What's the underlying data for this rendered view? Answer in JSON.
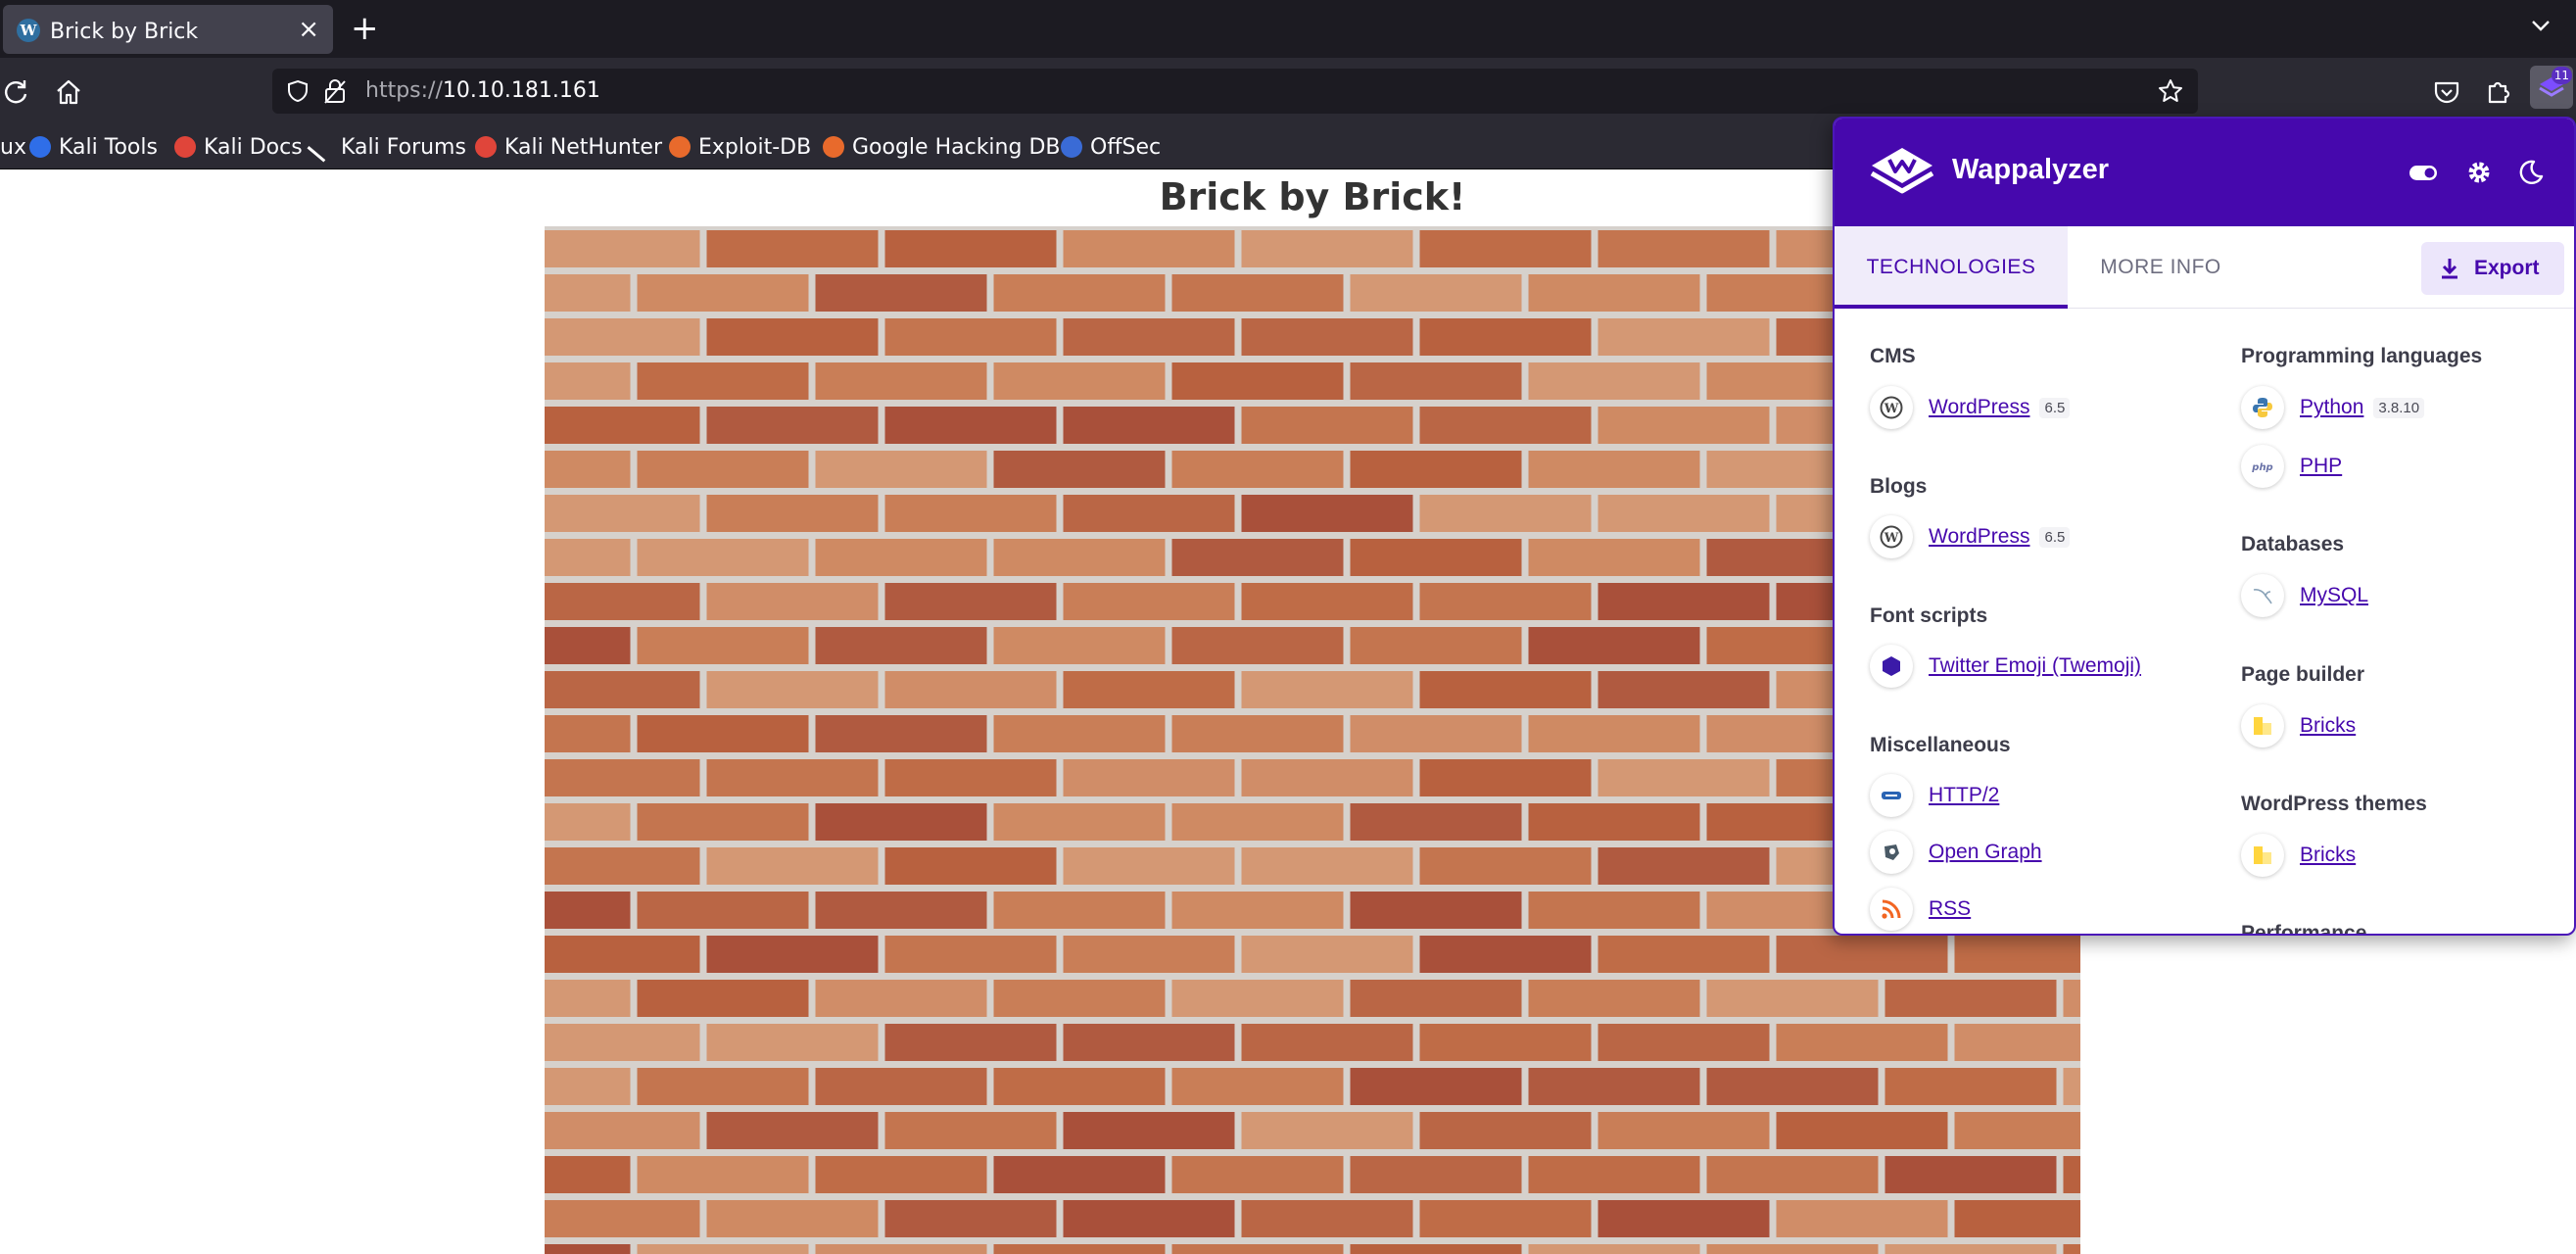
{
  "browser": {
    "tab_title": "Brick by Brick",
    "tab_close": "×",
    "new_tab": "+",
    "url_proto": "https://",
    "url_host": "10.10.181.161",
    "extension_badge": "11",
    "bookmarks": [
      "ux",
      "Kali Tools",
      "Kali Docs",
      "Kali Forums",
      "Kali NetHunter",
      "Exploit-DB",
      "Google Hacking DB",
      "OffSec"
    ]
  },
  "page": {
    "heading": "Brick by Brick!"
  },
  "wappalyzer": {
    "brand": "Wappalyzer",
    "tabs": {
      "technologies": "TECHNOLOGIES",
      "more_info": "MORE INFO"
    },
    "export_label": "Export",
    "left_categories": [
      {
        "name": "CMS",
        "items": [
          {
            "name": "WordPress",
            "version": "6.5",
            "icon": "wordpress-icon"
          }
        ]
      },
      {
        "name": "Blogs",
        "items": [
          {
            "name": "WordPress",
            "version": "6.5",
            "icon": "wordpress-icon"
          }
        ]
      },
      {
        "name": "Font scripts",
        "items": [
          {
            "name": "Twitter Emoji (Twemoji)",
            "version": "",
            "icon": "twemoji-icon"
          }
        ]
      },
      {
        "name": "Miscellaneous",
        "items": [
          {
            "name": "HTTP/2",
            "version": "",
            "icon": "http2-icon"
          },
          {
            "name": "Open Graph",
            "version": "",
            "icon": "open-graph-icon"
          },
          {
            "name": "RSS",
            "version": "",
            "icon": "rss-icon"
          }
        ]
      }
    ],
    "right_categories": [
      {
        "name": "Programming languages",
        "items": [
          {
            "name": "Python",
            "version": "3.8.10",
            "icon": "python-icon"
          },
          {
            "name": "PHP",
            "version": "",
            "icon": "php-icon"
          }
        ]
      },
      {
        "name": "Databases",
        "items": [
          {
            "name": "MySQL",
            "version": "",
            "icon": "mysql-icon"
          }
        ]
      },
      {
        "name": "Page builder",
        "items": [
          {
            "name": "Bricks",
            "version": "",
            "icon": "bricks-icon"
          }
        ]
      },
      {
        "name": "WordPress themes",
        "items": [
          {
            "name": "Bricks",
            "version": "",
            "icon": "bricks-icon"
          }
        ]
      },
      {
        "name": "Performance",
        "items": []
      }
    ]
  },
  "colors": {
    "wappalyzer_purple": "#4608ad",
    "chrome_dark": "#1c1b22",
    "chrome_toolbar": "#2b2a33"
  }
}
